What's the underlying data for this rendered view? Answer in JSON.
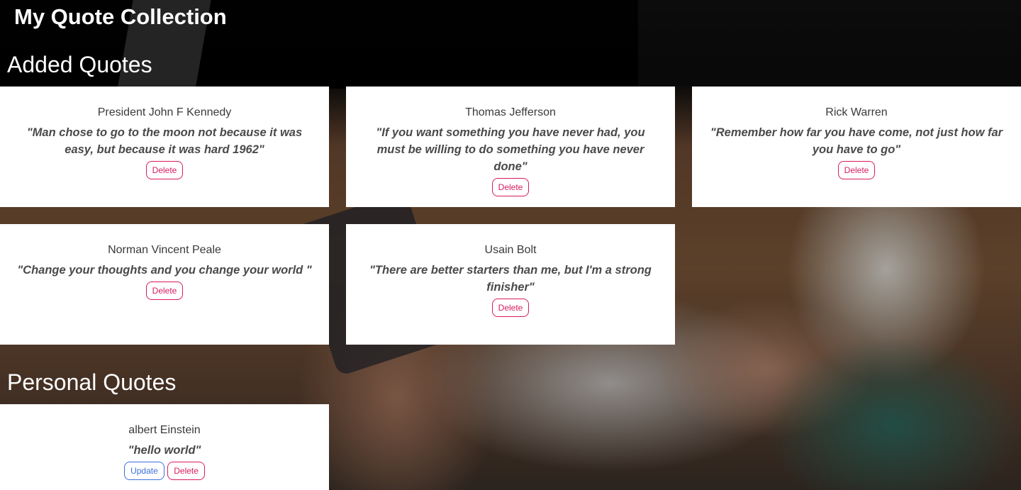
{
  "app": {
    "title": "My Quote Collection"
  },
  "added_section": {
    "title": "Added Quotes"
  },
  "personal_section": {
    "title": "Personal Quotes"
  },
  "buttons": {
    "delete_label": "Delete",
    "update_label": "Update"
  },
  "added_quotes": [
    {
      "author": "President John F Kennedy",
      "quote": "\"Man chose to go to the moon not because it was easy, but because it was hard 1962\""
    },
    {
      "author": "Thomas Jefferson",
      "quote": "\"If you want something you have never had, you must be willing to do something you have never done\""
    },
    {
      "author": "Rick Warren",
      "quote": "\"Remember how far you have come, not just how far you have to go\""
    },
    {
      "author": "Norman Vincent Peale",
      "quote": "\"Change your thoughts and you change your world \""
    },
    {
      "author": "Usain Bolt",
      "quote": "\"There are better starters than me, but I'm a strong finisher\""
    }
  ],
  "personal_quotes": [
    {
      "author": "albert Einstein",
      "quote": "\"hello world\""
    }
  ],
  "colors": {
    "delete": "#d81b60",
    "update": "#3b6fd8",
    "card": "#ffffff"
  }
}
